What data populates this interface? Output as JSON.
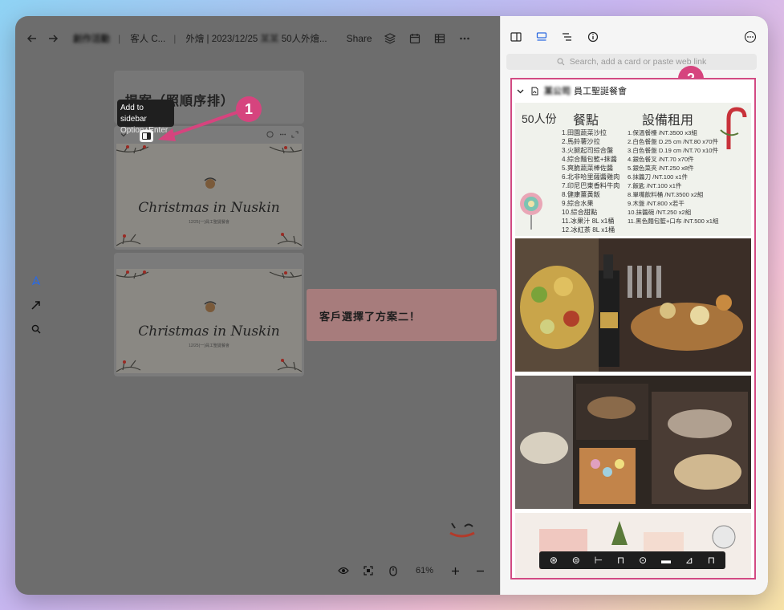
{
  "topbar": {
    "crumb1": "創作活動",
    "crumb2": "客人 C...",
    "crumb3": "外燴 | 2023/12/25",
    "crumb3_blur": "某某",
    "crumb3_tail": "50人外燴...",
    "share": "Share"
  },
  "canvas": {
    "title_card": "提案（照順序排）",
    "tooltip_title": "Add to sidebar",
    "tooltip_shortcut": "Option+Enter",
    "card1_script": "Christmas in Nuskin",
    "card1_tiny": "12/25(一)員工聖誕餐會",
    "card2_script": "Christmas in Nuskin",
    "card2_tiny": "12/25(一)員工聖誕餐會",
    "note": "客戶選擇了方案二！",
    "callout1": "1",
    "callout2": "2"
  },
  "bottombar": {
    "zoom": "61%"
  },
  "panel": {
    "search_placeholder": "Search, add a card or paste web link",
    "embed_name_blur": "某公司",
    "embed_title": "員工聖誕餐會",
    "menu": {
      "count": "50人份",
      "food_heading": "餐點",
      "equip_heading": "設備租用",
      "food": [
        "1.田園蔬菜沙拉",
        "2.馬鈴薯沙拉",
        "3.火腿起司綜合盤",
        "4.綜合麵包籃+抹醬",
        "5.爽脆蔬菜棒佐醬",
        "6.北非哈里薩醬雞肉",
        "7.印尼巴東香料牛肉",
        "8.健康薑黃飯",
        "9.綜合水果",
        "10.綜合甜點",
        "11.冰果汁 8L x1桶",
        "12.冰紅茶 8L x1桶"
      ],
      "equip": [
        "1.保溫餐檯 /NT.3500 x3組",
        "2.白色餐盤 D.25 cm /NT.80 x70件",
        "3.白色餐盤 D.19 cm /NT.70 x10件",
        "4.銀色餐叉 /NT.70 x70件",
        "5.銀色菜夾 /NT.250 x8件",
        "6.抹醬刀 /NT.100 x1件",
        "7.飯匙 /NT.100 x1件",
        "8.單嘴飲料桶 /NT.3500 x2組",
        "9.木盤 /NT.800 x若干",
        "10.抹醬碗 /NT.250 x2組",
        "11.黑色麵包籃+口布 /NT.500 x1組"
      ]
    }
  },
  "colors": {
    "accent": "#d24a83",
    "note": "#a77c7c",
    "active": "#2c6ae0"
  }
}
